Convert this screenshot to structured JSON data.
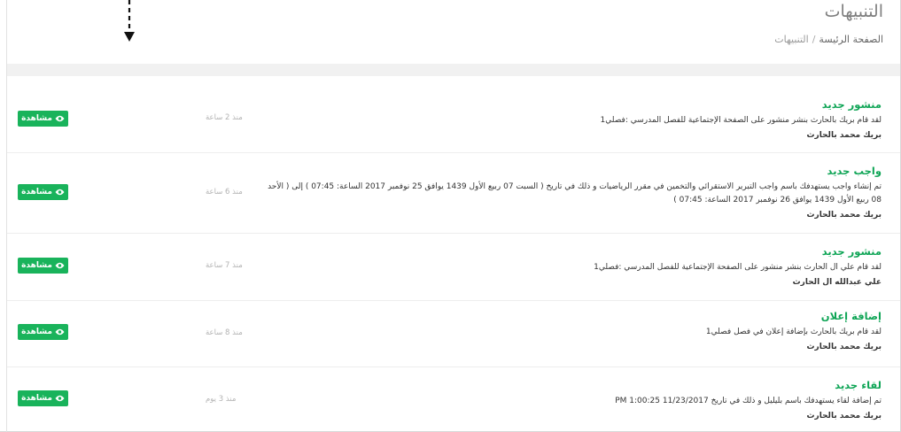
{
  "header": {
    "title": "التنبيهات",
    "breadcrumb": {
      "home": "الصفحة الرئيسة",
      "separator": "/",
      "current": "التنبيهات"
    }
  },
  "accent_color": "#19b35b",
  "title_color": "#0fa556",
  "notifications": [
    {
      "title": "منشور جديد",
      "text": "لقد قام بريك بالحارث بنشر منشور على الصفحة الإجتماعية للفصل المدرسي :فصلي1",
      "author": "بريك محمد بالحارث",
      "time": "منذ 2 ساعة",
      "button": "مشاهدة"
    },
    {
      "title": "واجب جديد",
      "text": "تم إنشاء واجب يستهدفك باسم واجب التبرير الاستقرائي والتخمين في مقرر الرياضيات و ذلك في تاريخ ( السبت 07 ربيع الأول 1439 يوافق 25 نوفمبر 2017 الساعة: 07:45 ) إلى ( الأحد 08 ربيع الأول 1439 يوافق 26 نوفمبر 2017 الساعة: 07:45 )",
      "author": "بريك محمد بالحارث",
      "time": "منذ 6 ساعة",
      "button": "مشاهدة"
    },
    {
      "title": "منشور جديد",
      "text": "لقد قام علي ال الحارث بنشر منشور على الصفحة الإجتماعية للفصل المدرسي :فصلي1",
      "author": "علي عبدالله ال الحارث",
      "time": "منذ 7 ساعة",
      "button": "مشاهدة"
    },
    {
      "title": "إضافة إعلان",
      "text": "لقد قام بريك بالحارث بإضافة إعلان في فصل فصلي1",
      "author": "بريك محمد بالحارث",
      "time": "منذ 8 ساعة",
      "button": "مشاهدة"
    },
    {
      "title": "لقاء جديد",
      "text": "تم إضافة لقاء يستهدفك باسم بليليل و ذلك في تاريخ 11/23/2017 1:00:25 PM",
      "author": "بريك محمد بالحارث",
      "time": "منذ 3 يوم",
      "button": "مشاهدة"
    }
  ]
}
